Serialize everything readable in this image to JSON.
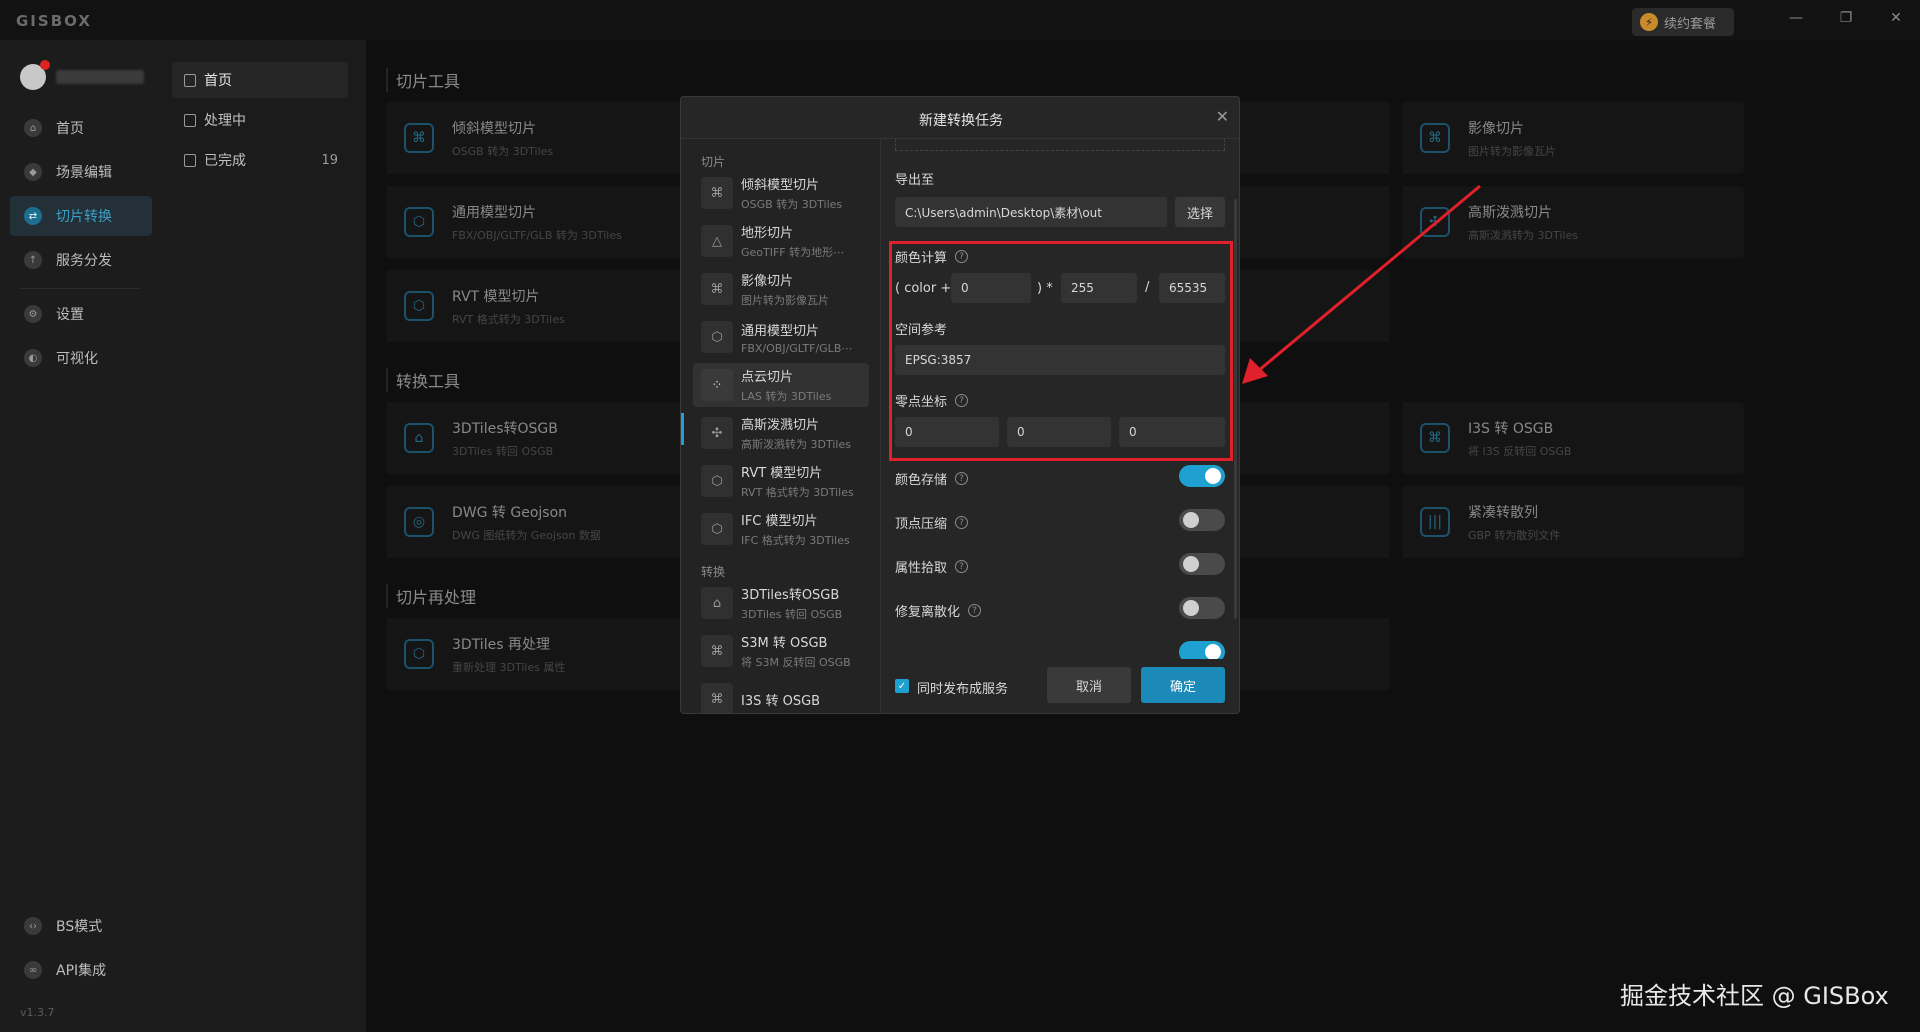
{
  "app": {
    "logo": "GISBOX",
    "renew_label": "续约套餐",
    "bolt_icon": "⚡"
  },
  "window_controls": {
    "minimize": "—",
    "maximize": "❐",
    "close": "✕"
  },
  "sidebar": {
    "items": [
      {
        "label": "首页",
        "icon": "home-icon",
        "glyph": "⌂"
      },
      {
        "label": "场景编辑",
        "icon": "scene-icon",
        "glyph": "◆"
      },
      {
        "label": "切片转换",
        "icon": "convert-icon",
        "glyph": "⇄"
      },
      {
        "label": "服务分发",
        "icon": "upload-icon",
        "glyph": "↑"
      },
      {
        "label": "设置",
        "icon": "gear-icon",
        "glyph": "⚙"
      },
      {
        "label": "可视化",
        "icon": "visual-icon",
        "glyph": "◐"
      },
      {
        "label": "BS模式",
        "icon": "code-icon",
        "glyph": "‹›"
      },
      {
        "label": "API集成",
        "icon": "link-icon",
        "glyph": "∞"
      }
    ],
    "version": "v1.3.7"
  },
  "sub_sidebar": {
    "items": [
      {
        "label": "首页"
      },
      {
        "label": "处理中"
      },
      {
        "label": "已完成",
        "count": "19"
      }
    ]
  },
  "main": {
    "sections": [
      {
        "title": "切片工具"
      },
      {
        "title": "转换工具"
      },
      {
        "title": "切片再处理"
      }
    ],
    "cards": [
      {
        "title": "倾斜模型切片",
        "sub": "OSGB 转为 3DTiles",
        "glyph": "⌘"
      },
      {
        "title": "通用模型切片",
        "sub": "FBX/OBJ/GLTF/GLB 转为 3DTiles",
        "glyph": "⬡"
      },
      {
        "title": "RVT 模型切片",
        "sub": "RVT 格式转为 3DTiles",
        "glyph": "⬡"
      },
      {
        "title": "影像切片",
        "sub": "图片转为影像瓦片",
        "glyph": "⌘"
      },
      {
        "title": "高斯泼溅切片",
        "sub": "高斯泼溅转为 3DTiles",
        "glyph": "✣"
      },
      {
        "title": "3DTiles转OSGB",
        "sub": "3DTiles 转回 OSGB",
        "glyph": "⌂"
      },
      {
        "title": "DWG 转 Geojson",
        "sub": "DWG 图纸转为 Geojson 数据",
        "glyph": "◎"
      },
      {
        "title": "I3S 转 OSGB",
        "sub": "将 I3S 反转回 OSGB",
        "glyph": "⌘"
      },
      {
        "title": "紧凑转散列",
        "sub": "GBP 转为散列文件",
        "glyph": "|||"
      },
      {
        "title": "3DTiles 再处理",
        "sub": "重新处理 3DTiles 属性",
        "glyph": "⬡"
      }
    ]
  },
  "modal": {
    "title": "新建转换任务",
    "close": "✕",
    "groups": {
      "slice": "切片",
      "convert": "转换"
    },
    "list": [
      {
        "title": "倾斜模型切片",
        "sub": "OSGB 转为 3DTiles",
        "glyph": "⌘"
      },
      {
        "title": "地形切片",
        "sub": "GeoTIFF 转为地形⋯",
        "glyph": "△"
      },
      {
        "title": "影像切片",
        "sub": "图片转为影像瓦片",
        "glyph": "⌘"
      },
      {
        "title": "通用模型切片",
        "sub": "FBX/OBJ/GLTF/GLB⋯",
        "glyph": "⬡"
      },
      {
        "title": "点云切片",
        "sub": "LAS 转为 3DTiles",
        "glyph": "⁘"
      },
      {
        "title": "高斯泼溅切片",
        "sub": "高斯泼溅转为 3DTiles",
        "glyph": "✣"
      },
      {
        "title": "RVT 模型切片",
        "sub": "RVT 格式转为 3DTiles",
        "glyph": "⬡"
      },
      {
        "title": "IFC 模型切片",
        "sub": "IFC 格式转为 3DTiles",
        "glyph": "⬡"
      },
      {
        "title": "3DTiles转OSGB",
        "sub": "3DTiles 转回 OSGB",
        "glyph": "⌂"
      },
      {
        "title": "S3M 转 OSGB",
        "sub": "将 S3M 反转回 OSGB",
        "glyph": "⌘"
      },
      {
        "title": "I3S 转 OSGB",
        "sub": "",
        "glyph": "⌘"
      }
    ],
    "form": {
      "export_label": "导出至",
      "export_path": "C:\\Users\\admin\\Desktop\\素材\\out",
      "select_label": "选择",
      "color_calc_label": "颜色计算",
      "color_prefix": "( color +",
      "color_add": "0",
      "color_mid": ") *",
      "color_mul": "255",
      "color_div_sign": "/",
      "color_div": "65535",
      "srs_label": "空间参考",
      "srs_value": "EPSG:3857",
      "origin_label": "零点坐标",
      "origin": [
        "0",
        "0",
        "0"
      ],
      "toggles": [
        {
          "label": "颜色存储",
          "on": true
        },
        {
          "label": "顶点压缩",
          "on": false
        },
        {
          "label": "属性拾取",
          "on": false
        },
        {
          "label": "修复离散化",
          "on": false
        }
      ],
      "help": "?"
    },
    "footer": {
      "publish_label": "同时发布成服务",
      "publish_checked": true,
      "check_glyph": "✓",
      "cancel_label": "取消",
      "ok_label": "确定"
    }
  },
  "watermark": "掘金技术社区 @ GISBox"
}
